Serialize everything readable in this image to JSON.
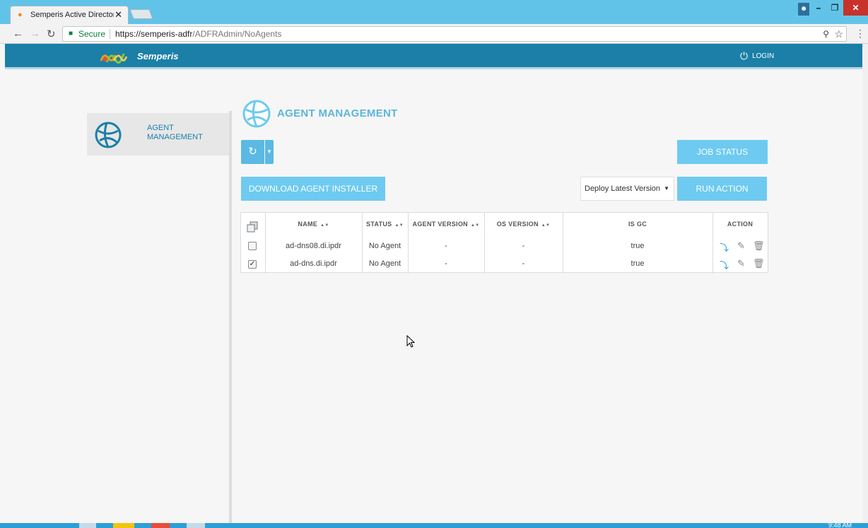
{
  "browser": {
    "tab_title": "Semperis Active Directory",
    "secure_label": "Secure",
    "url_host": "https://semperis-adfr",
    "url_path": "/ADFRAdmin/NoAgents"
  },
  "header": {
    "brand": "Semperis",
    "login_label": "LOGIN"
  },
  "sidebar": {
    "items": [
      {
        "label": "AGENT MANAGEMENT"
      }
    ]
  },
  "page": {
    "title": "AGENT MANAGEMENT"
  },
  "toolbar": {
    "job_status_label": "JOB STATUS",
    "download_label": "DOWNLOAD AGENT INSTALLER",
    "deploy_select_value": "Deploy Latest Version",
    "run_action_label": "RUN ACTION"
  },
  "table": {
    "columns": [
      "NAME",
      "STATUS",
      "AGENT VERSION",
      "OS VERSION",
      "IS GC",
      "ACTION"
    ],
    "rows": [
      {
        "name": "ad-dns08.di.ipdr",
        "status": "No Agent",
        "agent_version": "-",
        "os_version": "-",
        "is_gc": "true",
        "checked": false
      },
      {
        "name": "ad-dns.di.ipdr",
        "status": "No Agent",
        "agent_version": "-",
        "os_version": "-",
        "is_gc": "true",
        "checked": true
      }
    ]
  },
  "taskbar": {
    "clock": "9:48 AM"
  },
  "colors": {
    "brand_blue": "#1b7fa8",
    "button_blue": "#6ecaf0",
    "title_blue": "#5bb6d9",
    "titlebar": "#62c3e8",
    "close_red": "#c7322b"
  },
  "icons": [
    "lock-icon",
    "key-icon",
    "star-icon",
    "power-icon",
    "globe-icon",
    "refresh-icon",
    "deploy-icon",
    "edit-icon",
    "trash-icon"
  ]
}
